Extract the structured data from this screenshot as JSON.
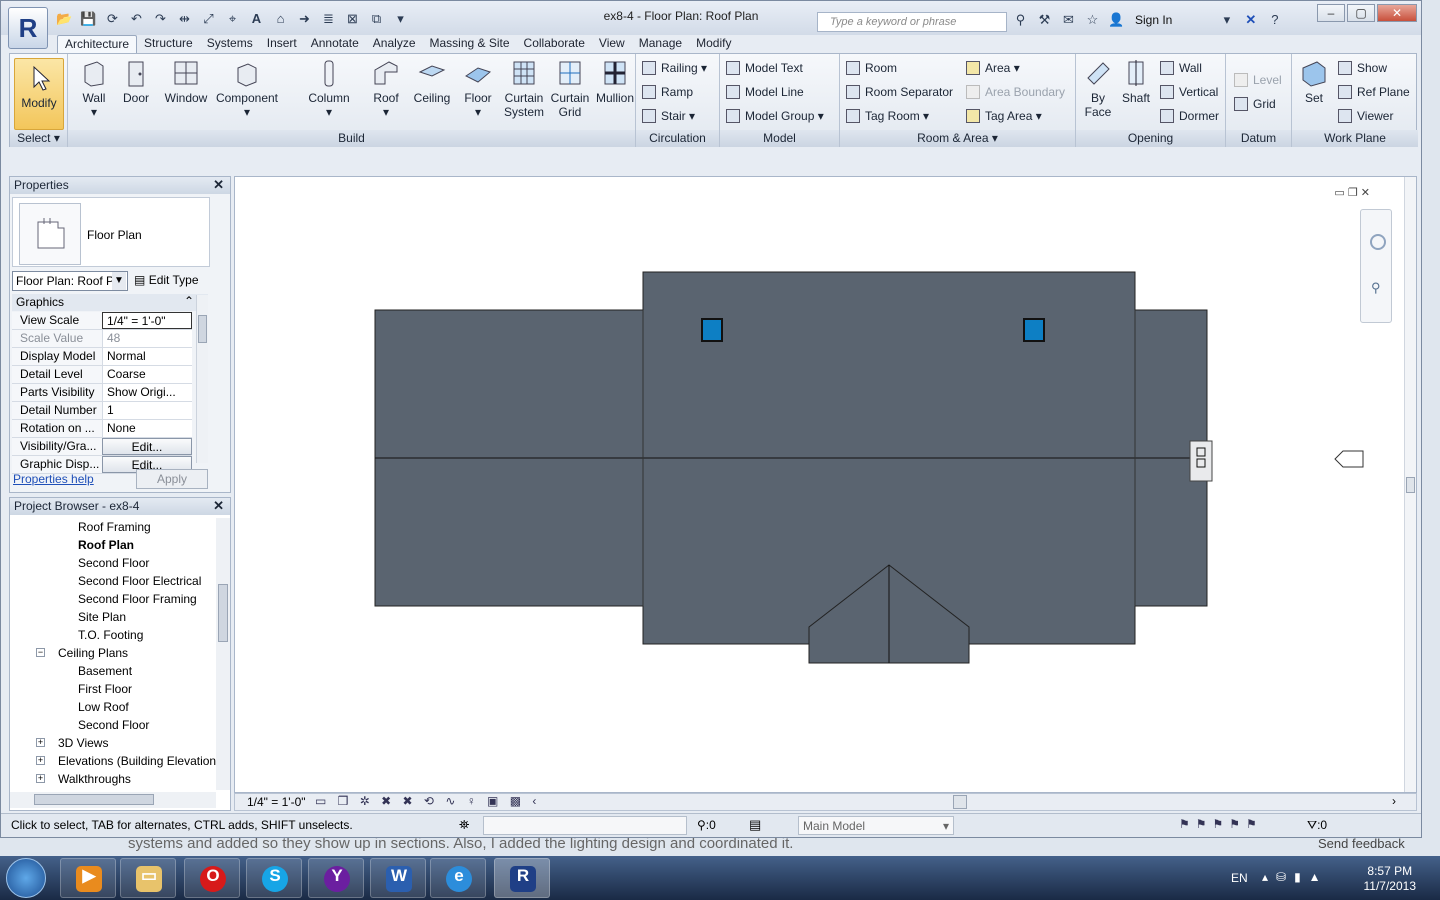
{
  "window": {
    "title": "ex8-4 - Floor Plan: Roof Plan"
  },
  "search": {
    "placeholder": "Type a keyword or phrase"
  },
  "infocenter": {
    "sign_in": "Sign In"
  },
  "tabs": [
    "Architecture",
    "Structure",
    "Systems",
    "Insert",
    "Annotate",
    "Analyze",
    "Massing & Site",
    "Collaborate",
    "View",
    "Manage",
    "Modify"
  ],
  "ribbon": {
    "select": {
      "modify": "Modify",
      "title": "Select"
    },
    "build": {
      "wall": "Wall",
      "door": "Door",
      "window": "Window",
      "component": "Component",
      "column": "Column",
      "roof": "Roof",
      "ceiling": "Ceiling",
      "floor": "Floor",
      "curtain_system_1": "Curtain",
      "curtain_system_2": "System",
      "curtain_grid_1": "Curtain",
      "curtain_grid_2": "Grid",
      "mullion": "Mullion",
      "title": "Build"
    },
    "circulation": {
      "railing": "Railing",
      "ramp": "Ramp",
      "stair": "Stair",
      "title": "Circulation"
    },
    "model": {
      "text": "Model  Text",
      "line": "Model  Line",
      "group": "Model  Group",
      "title": "Model"
    },
    "room_area": {
      "room": "Room",
      "separator": "Room  Separator",
      "tag_room": "Tag  Room",
      "area": "Area",
      "area_boundary": "Area  Boundary",
      "tag_area": "Tag  Area",
      "title": "Room & Area"
    },
    "opening": {
      "by_face_1": "By",
      "by_face_2": "Face",
      "shaft": "Shaft",
      "wall": "Wall",
      "vertical": "Vertical",
      "dormer": "Dormer",
      "title": "Opening"
    },
    "datum": {
      "level": "Level",
      "grid": "Grid",
      "title": "Datum"
    },
    "work_plane": {
      "set": "Set",
      "show": "Show",
      "ref_plane": "Ref  Plane",
      "viewer": "Viewer",
      "title": "Work Plane"
    }
  },
  "properties": {
    "title": "Properties",
    "type_name": "Floor Plan",
    "instance": "Floor Plan: Roof P",
    "edit_type": "Edit Type",
    "group": "Graphics",
    "rows": [
      {
        "k": "View Scale",
        "v": "1/4\" = 1'-0\""
      },
      {
        "k": "Scale Value",
        "v": "48"
      },
      {
        "k": "Display Model",
        "v": "Normal"
      },
      {
        "k": "Detail Level",
        "v": "Coarse"
      },
      {
        "k": "Parts Visibility",
        "v": "Show Origi..."
      },
      {
        "k": "Detail Number",
        "v": "1"
      },
      {
        "k": "Rotation on ...",
        "v": "None"
      },
      {
        "k": "Visibility/Gra...",
        "v": "Edit..."
      },
      {
        "k": "Graphic Disp...",
        "v": "Edit..."
      }
    ],
    "help": "Properties help",
    "apply": "Apply"
  },
  "browser": {
    "title": "Project Browser - ex8-4",
    "items": [
      {
        "t": "Roof Framing",
        "lvl": 2
      },
      {
        "t": "Roof Plan",
        "lvl": 2,
        "bold": true
      },
      {
        "t": "Second Floor",
        "lvl": 2
      },
      {
        "t": "Second Floor Electrical",
        "lvl": 2
      },
      {
        "t": "Second Floor Framing",
        "lvl": 2
      },
      {
        "t": "Site Plan",
        "lvl": 2
      },
      {
        "t": "T.O. Footing",
        "lvl": 2
      },
      {
        "t": "Ceiling Plans",
        "lvl": 1,
        "toggle": "−"
      },
      {
        "t": "Basement",
        "lvl": 2
      },
      {
        "t": "First Floor",
        "lvl": 2
      },
      {
        "t": "Low Roof",
        "lvl": 2
      },
      {
        "t": "Second Floor",
        "lvl": 2
      },
      {
        "t": "3D Views",
        "lvl": 1,
        "toggle": "+"
      },
      {
        "t": "Elevations (Building Elevation",
        "lvl": 1,
        "toggle": "+"
      },
      {
        "t": "Walkthroughs",
        "lvl": 1,
        "toggle": "+"
      }
    ]
  },
  "viewcontrol": {
    "scale": "1/4\" = 1'-0\""
  },
  "status": {
    "text": "Click to select, TAB for alternates, CTRL adds, SHIFT unselects.",
    "count": ":0",
    "model": "Main Model",
    "filter": ":0"
  },
  "taskbar": {
    "lang": "EN",
    "time": "8:57 PM",
    "date": "11/7/2013"
  },
  "background": {
    "behind_text": "systems and added so they show up in sections. Also, I added the lighting design and coordinated it.",
    "feedback": "Send feedback"
  },
  "colors": {
    "roof": "#5a6470",
    "skylight": "#0d7fc4",
    "selected": "#f3c65b"
  }
}
